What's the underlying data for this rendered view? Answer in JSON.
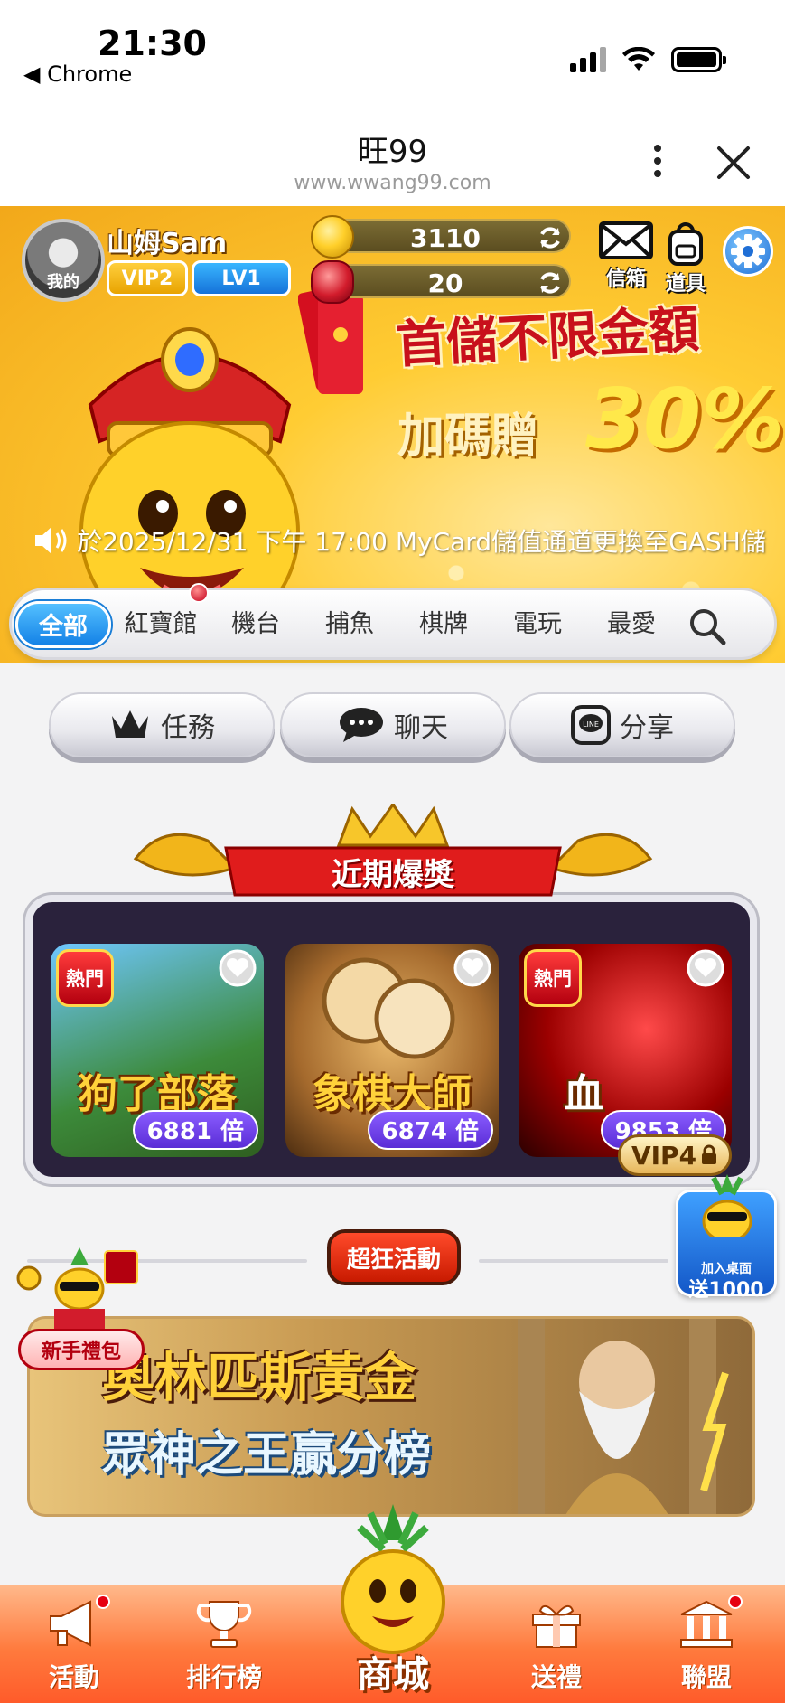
{
  "status_bar": {
    "time": "21:30",
    "back_app": "◀ Chrome"
  },
  "browser": {
    "title": "旺99",
    "url": "www.wwang99.com"
  },
  "profile": {
    "avatar_label": "我的",
    "username": "山姆Sam",
    "vip_badge": "VIP2",
    "level_badge": "LV1"
  },
  "wallet": {
    "gold": "3110",
    "gems": "20"
  },
  "hud": {
    "mailbox_label": "信箱",
    "items_label": "道具"
  },
  "promo": {
    "line1": "首儲不限金額",
    "line2": "加碼贈",
    "line2_highlight": "30%"
  },
  "announcement": "於2025/12/31 下午 17:00 MyCard儲值通道更換至GASH儲",
  "category_tabs": [
    {
      "label": "全部",
      "active": true
    },
    {
      "label": "紅寶館",
      "active": false
    },
    {
      "label": "機台",
      "active": false
    },
    {
      "label": "捕魚",
      "active": false
    },
    {
      "label": "棋牌",
      "active": false
    },
    {
      "label": "電玩",
      "active": false
    },
    {
      "label": "最愛",
      "active": false
    }
  ],
  "actions": {
    "tasks_label": "任務",
    "chat_label": "聊天",
    "share_label": "分享",
    "line_icon_text": "LINE"
  },
  "jackpot": {
    "title": "近期爆獎",
    "games": [
      {
        "name": "狗了部落",
        "multiplier": "6881 倍",
        "hot": "熱門"
      },
      {
        "name": "象棋大師",
        "multiplier": "6874 倍",
        "hot": ""
      },
      {
        "name": "血",
        "multiplier": "9853 倍",
        "hot": "熱門"
      }
    ],
    "vip_lock_label": "VIP4"
  },
  "events": {
    "section_title": "超狂活動",
    "banner_title1": "奧林匹斯黃金",
    "banner_title2": "眾神之王贏分榜"
  },
  "floating": {
    "newbie_label": "新手禮包",
    "desktop_line1": "加入桌面",
    "desktop_line2": "送1000"
  },
  "bottom_nav": {
    "activity": "活動",
    "ranking": "排行榜",
    "shop": "商城",
    "gift": "送禮",
    "alliance": "聯盟"
  },
  "colors": {
    "accent_blue": "#1381e6",
    "brand_orange": "#ff7a3d",
    "alert_red": "#e60012"
  }
}
